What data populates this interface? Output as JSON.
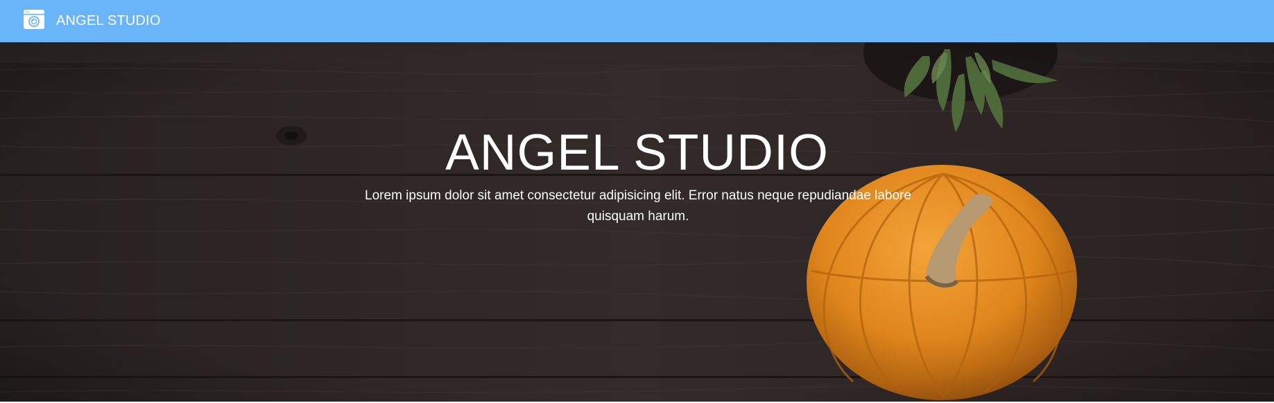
{
  "navbar": {
    "brand_icon": "camera-window-icon",
    "brand_title": "ANGEL STUDIO"
  },
  "hero": {
    "title": "ANGEL STUDIO",
    "text": "Lorem ipsum dolor sit amet consectetur adipisicing elit. Error natus neque repudiandae labore quisquam harum.",
    "background": "dark-wood-table-with-pumpkin-and-succulent-photo"
  },
  "colors": {
    "navbar": "#6ab4f9",
    "hero_text": "#ffffff",
    "wood": "#2b2523",
    "pumpkin": "#e08a1e"
  }
}
